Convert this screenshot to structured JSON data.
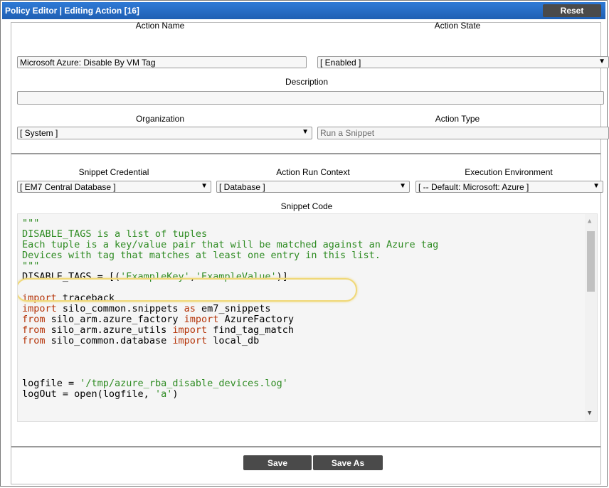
{
  "window": {
    "title": "Policy Editor | Editing Action [16]",
    "reset_label": "Reset"
  },
  "form": {
    "action_name": {
      "label": "Action Name",
      "value": "Microsoft Azure: Disable By VM Tag"
    },
    "action_state": {
      "label": "Action State",
      "value": "[ Enabled ]"
    },
    "description": {
      "label": "Description",
      "value": ""
    },
    "organization": {
      "label": "Organization",
      "value": "[ System ]"
    },
    "action_type": {
      "label": "Action Type",
      "value": "Run a Snippet"
    },
    "snippet_credential": {
      "label": "Snippet Credential",
      "value": "[ EM7 Central Database ]"
    },
    "action_run_context": {
      "label": "Action Run Context",
      "value": "[ Database ]"
    },
    "execution_environment": {
      "label": "Execution Environment",
      "value": "[ -- Default: Microsoft: Azure ]"
    },
    "snippet_code_label": "Snippet Code"
  },
  "code_lines": [
    [
      {
        "t": "\"\"\"",
        "c": "green"
      }
    ],
    [
      {
        "t": "DISABLE_TAGS is a list of tuples",
        "c": "green"
      }
    ],
    [
      {
        "t": "Each tuple is a key/value pair that will be matched against an Azure tag",
        "c": "green"
      }
    ],
    [
      {
        "t": "Devices with tag that matches at least one entry in this list.",
        "c": "green"
      }
    ],
    [
      {
        "t": "\"\"\"",
        "c": "green"
      }
    ],
    [
      {
        "t": "DISABLE_TAGS = [(",
        "c": "txt"
      },
      {
        "t": "'ExampleKey'",
        "c": "str"
      },
      {
        "t": ",",
        "c": "txt"
      },
      {
        "t": "'ExampleValue'",
        "c": "str"
      },
      {
        "t": ")]",
        "c": "txt"
      }
    ],
    [],
    [
      {
        "t": "import",
        "c": "kw"
      },
      {
        "t": " traceback",
        "c": "txt"
      }
    ],
    [
      {
        "t": "import",
        "c": "kw"
      },
      {
        "t": " silo_common.snippets ",
        "c": "txt"
      },
      {
        "t": "as",
        "c": "kw"
      },
      {
        "t": " em7_snippets",
        "c": "txt"
      }
    ],
    [
      {
        "t": "from",
        "c": "kw"
      },
      {
        "t": " silo_arm.azure_factory ",
        "c": "txt"
      },
      {
        "t": "import",
        "c": "kw"
      },
      {
        "t": " AzureFactory",
        "c": "txt"
      }
    ],
    [
      {
        "t": "from",
        "c": "kw"
      },
      {
        "t": " silo_arm.azure_utils ",
        "c": "txt"
      },
      {
        "t": "import",
        "c": "kw"
      },
      {
        "t": " find_tag_match",
        "c": "txt"
      }
    ],
    [
      {
        "t": "from",
        "c": "kw"
      },
      {
        "t": " silo_common.database ",
        "c": "txt"
      },
      {
        "t": "import",
        "c": "kw"
      },
      {
        "t": " local_db",
        "c": "txt"
      }
    ],
    [],
    [],
    [],
    [
      {
        "t": "logfile = ",
        "c": "txt"
      },
      {
        "t": "'/tmp/azure_rba_disable_devices.log'",
        "c": "str"
      }
    ],
    [
      {
        "t": "logOut = open(logfile, ",
        "c": "txt"
      },
      {
        "t": "'a'",
        "c": "str"
      },
      {
        "t": ")",
        "c": "txt"
      }
    ]
  ],
  "buttons": {
    "save": "Save",
    "save_as": "Save As"
  },
  "colors": {
    "title_bar": "#2f7ad6",
    "button": "#4a4a4a",
    "highlight": "#f0d878",
    "code_green": "#2e8b22",
    "code_keyword": "#b5350a"
  }
}
